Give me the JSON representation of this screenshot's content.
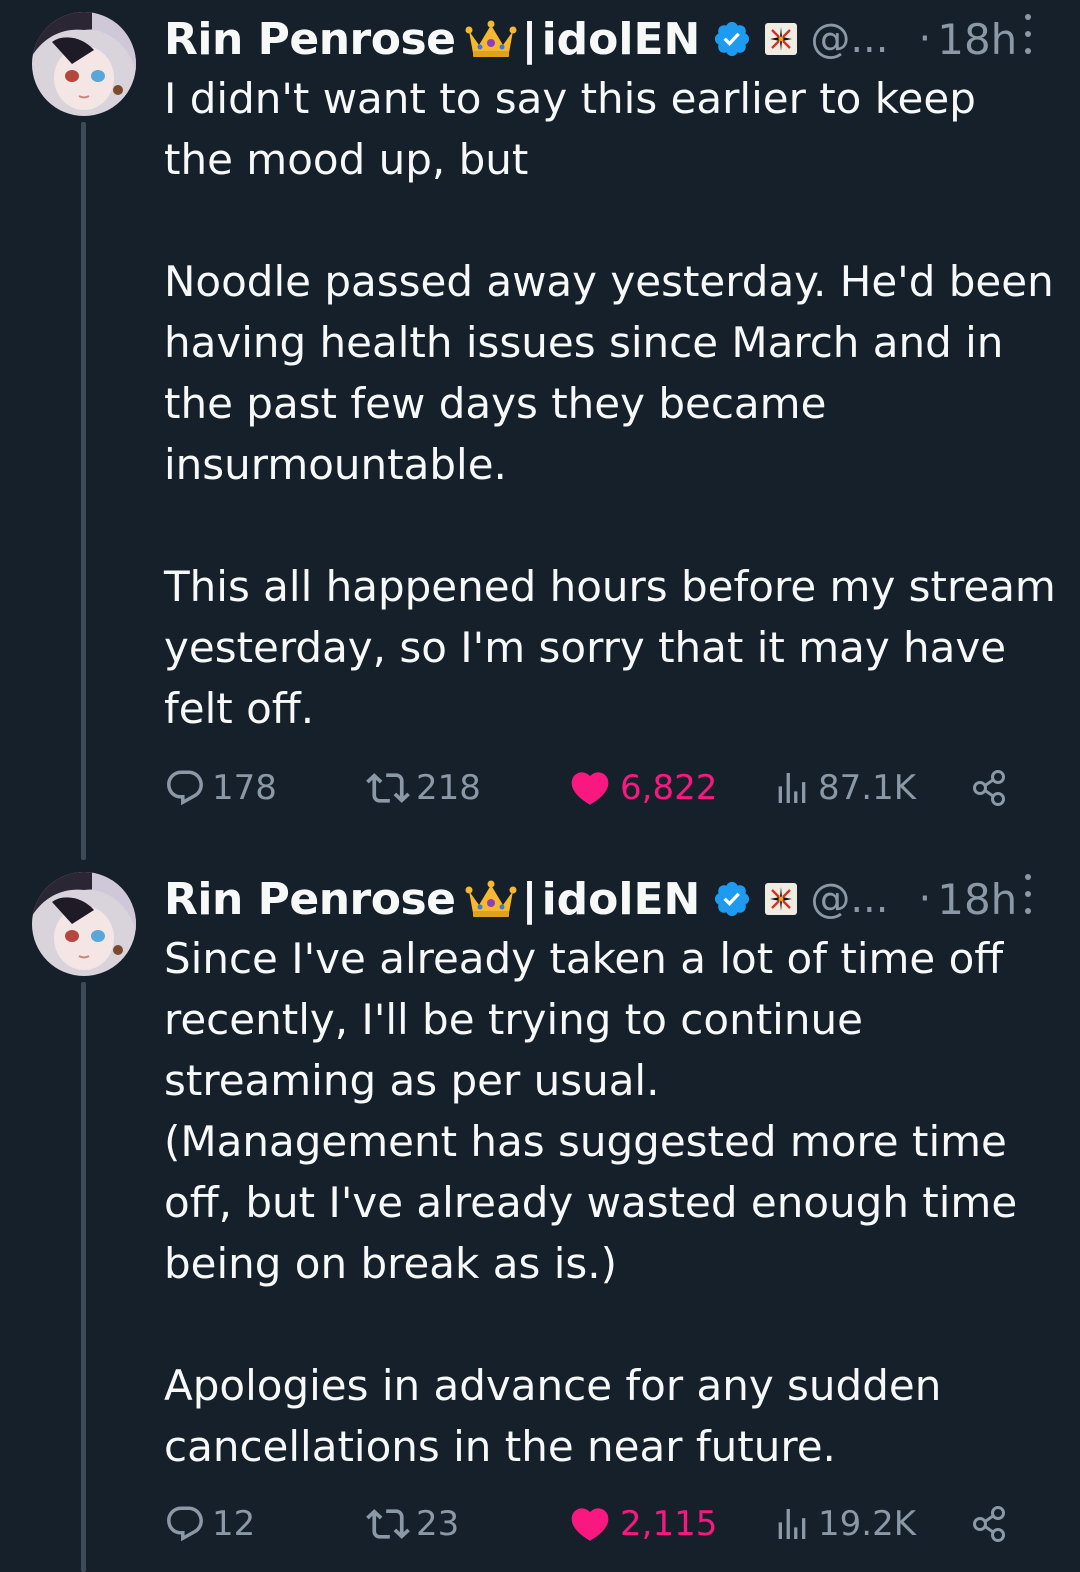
{
  "colors": {
    "background": "#15202b",
    "text": "#f7f9f9",
    "muted": "#8b98a5",
    "like": "#f91880",
    "verified": "#1d9bf0"
  },
  "tweets": [
    {
      "author": {
        "name": "Rin Penrose",
        "separator": "|",
        "affiliation": "idolEN",
        "handle": "@...",
        "dot": "·",
        "time": "18h",
        "icons": [
          "crown-emoji-icon",
          "verified-badge-icon",
          "affiliate-logo-icon"
        ]
      },
      "paragraphs": [
        "I didn't want to say this earlier to keep the mood up, but",
        "Noodle passed away yesterday. He'd been having health issues since March and in the past few days they became insurmountable.",
        "This all happened hours before my stream yesterday, so I'm sorry that it may have felt off."
      ],
      "stats": {
        "replies": "178",
        "reposts": "218",
        "likes": "6,822",
        "views": "87.1K"
      }
    },
    {
      "author": {
        "name": "Rin Penrose",
        "separator": "|",
        "affiliation": "idolEN",
        "handle": "@...",
        "dot": "·",
        "time": "18h",
        "icons": [
          "crown-emoji-icon",
          "verified-badge-icon",
          "affiliate-logo-icon"
        ]
      },
      "paragraphs": [
        "Since I've already taken a lot of time off recently, I'll be trying to continue streaming as per usual.\n(Management has suggested more time off, but I've already wasted enough time being on break as is.)",
        "Apologies in advance for any sudden cancellations in the near future."
      ],
      "stats": {
        "replies": "12",
        "reposts": "23",
        "likes": "2,115",
        "views": "19.2K"
      }
    }
  ]
}
